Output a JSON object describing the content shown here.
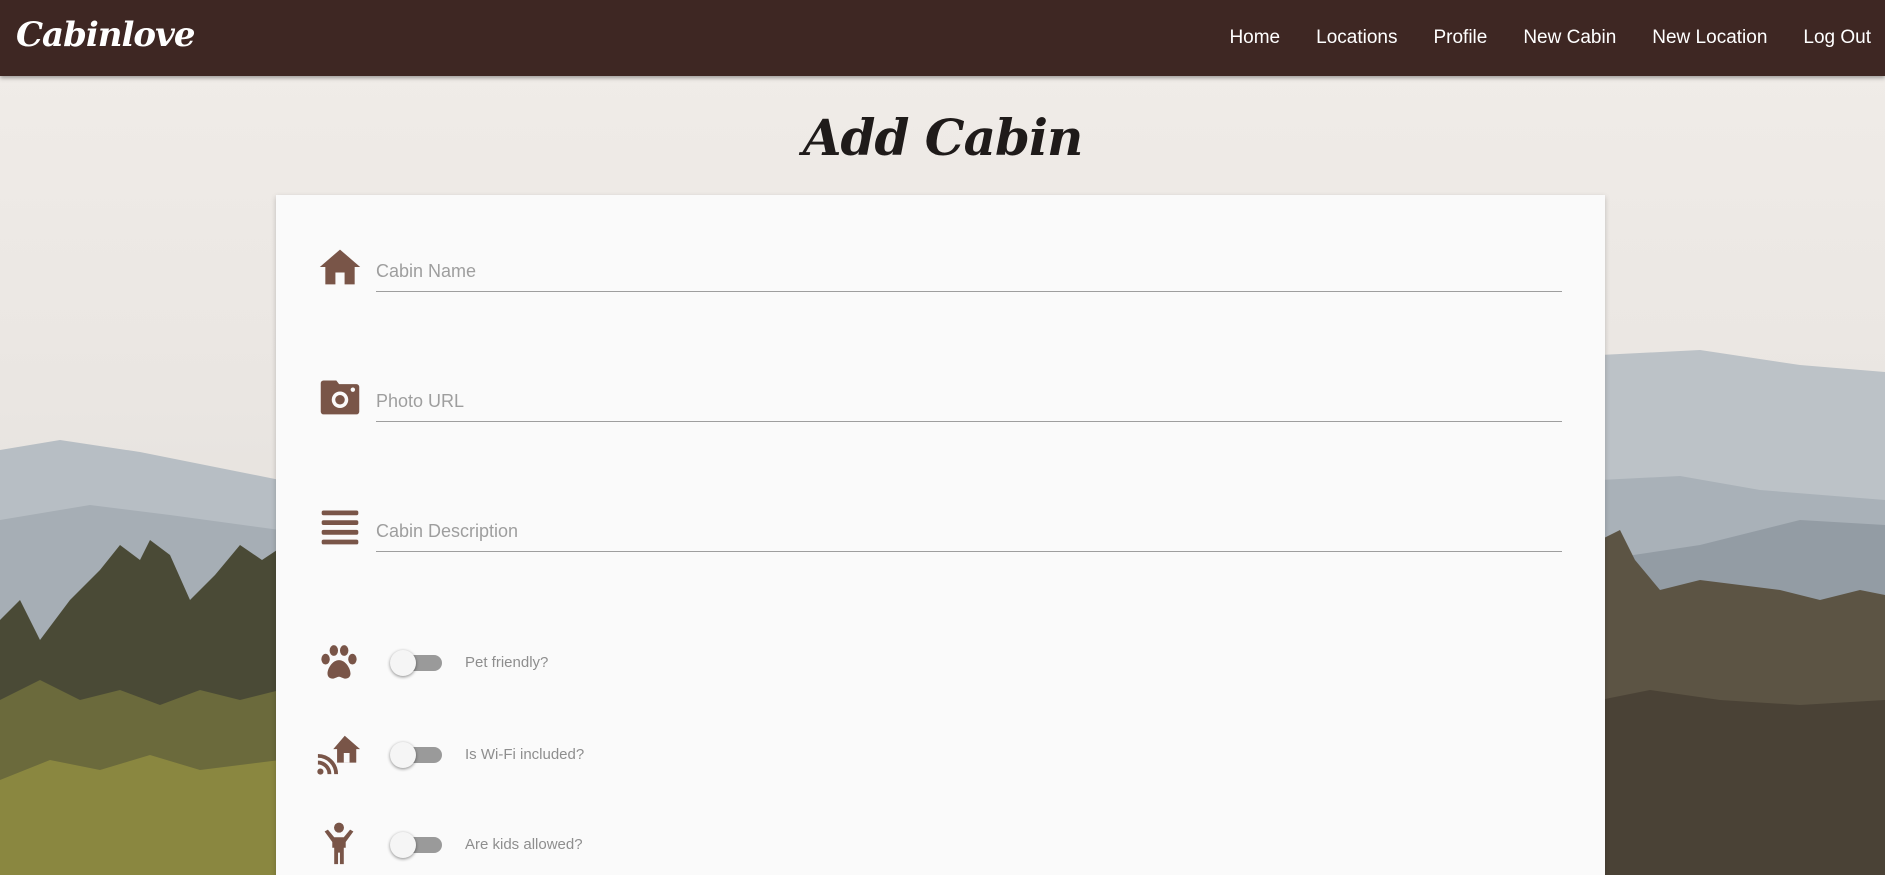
{
  "app": {
    "brand": "Cabinlove"
  },
  "nav": {
    "items": [
      {
        "label": "Home"
      },
      {
        "label": "Locations"
      },
      {
        "label": "Profile"
      },
      {
        "label": "New Cabin"
      },
      {
        "label": "New Location"
      },
      {
        "label": "Log Out"
      }
    ]
  },
  "page": {
    "title": "Add Cabin"
  },
  "form": {
    "name": {
      "placeholder": "Cabin Name",
      "value": "",
      "icon": "house-icon"
    },
    "photo": {
      "placeholder": "Photo URL",
      "value": "",
      "icon": "camera-icon"
    },
    "description": {
      "placeholder": "Cabin Description",
      "value": "",
      "icon": "lines-icon"
    },
    "switches": [
      {
        "label": "Pet friendly?",
        "checked": false,
        "icon": "paw-icon"
      },
      {
        "label": "Is Wi-Fi included?",
        "checked": false,
        "icon": "wifi-house-icon"
      },
      {
        "label": "Are kids allowed?",
        "checked": false,
        "icon": "child-icon"
      }
    ]
  },
  "colors": {
    "navbar": "#3e2723",
    "icon": "#795548",
    "card": "#fafafa"
  }
}
